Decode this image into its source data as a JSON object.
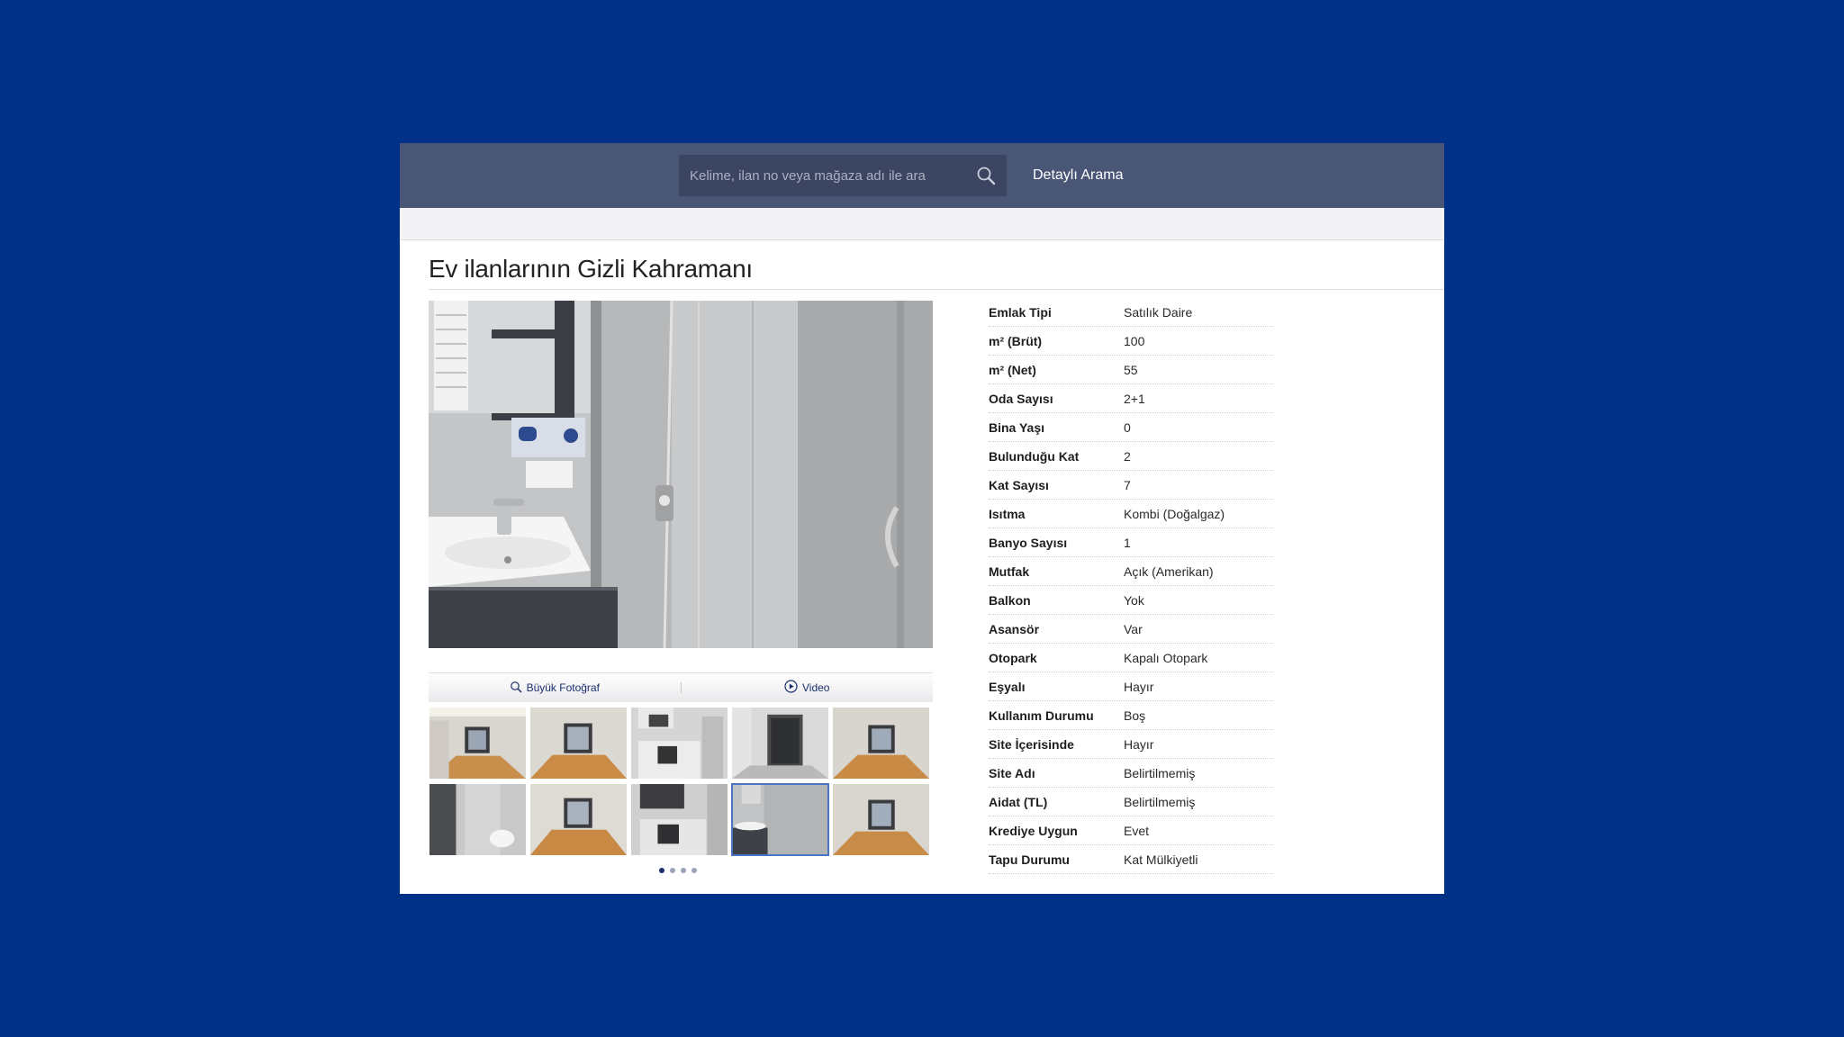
{
  "header": {
    "search": {
      "placeholder": "Kelime, ilan no veya mağaza adı ile ara",
      "value": ""
    },
    "detailed_search_label": "Detaylı Arama"
  },
  "listing": {
    "title": "Ev ilanlarının Gizli Kahramanı",
    "photo_actions": {
      "large_photo_label": "Büyük Fotoğraf",
      "video_label": "Video"
    },
    "gallery": {
      "thumbnail_count": 10,
      "selected_index": 8,
      "page_count": 4,
      "active_page": 1
    },
    "specs": [
      {
        "label": "Emlak Tipi",
        "value": "Satılık Daire"
      },
      {
        "label": "m² (Brüt)",
        "value": "100"
      },
      {
        "label": "m² (Net)",
        "value": "55"
      },
      {
        "label": "Oda Sayısı",
        "value": "2+1"
      },
      {
        "label": "Bina Yaşı",
        "value": "0"
      },
      {
        "label": "Bulunduğu Kat",
        "value": "2"
      },
      {
        "label": "Kat Sayısı",
        "value": "7"
      },
      {
        "label": "Isıtma",
        "value": "Kombi (Doğalgaz)"
      },
      {
        "label": "Banyo Sayısı",
        "value": "1"
      },
      {
        "label": "Mutfak",
        "value": "Açık (Amerikan)"
      },
      {
        "label": "Balkon",
        "value": "Yok"
      },
      {
        "label": "Asansör",
        "value": "Var"
      },
      {
        "label": "Otopark",
        "value": "Kapalı Otopark"
      },
      {
        "label": "Eşyalı",
        "value": "Hayır"
      },
      {
        "label": "Kullanım Durumu",
        "value": "Boş"
      },
      {
        "label": "Site İçerisinde",
        "value": "Hayır"
      },
      {
        "label": "Site Adı",
        "value": "Belirtilmemiş"
      },
      {
        "label": "Aidat (TL)",
        "value": "Belirtilmemiş"
      },
      {
        "label": "Krediye Uygun",
        "value": "Evet"
      },
      {
        "label": "Tapu Durumu",
        "value": "Kat Mülkiyetli"
      }
    ]
  },
  "colors": {
    "page_background": "#003087",
    "header_bar": "#4a5676",
    "search_box": "#3b4562",
    "link_blue": "#1a2f6b"
  }
}
